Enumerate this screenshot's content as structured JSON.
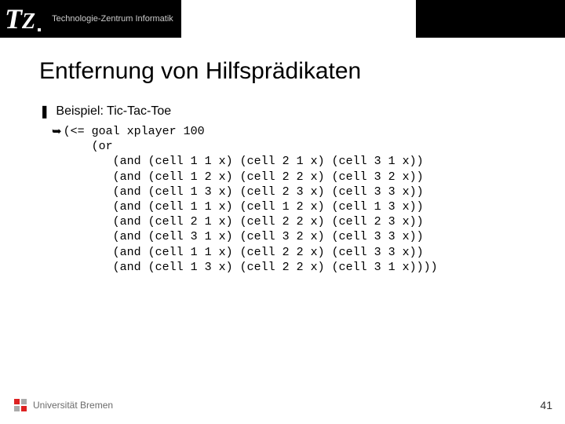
{
  "header": {
    "logo_t": "T",
    "logo_z": "Z",
    "subtitle": "Technologie-Zentrum Informatik"
  },
  "title": "Entfernung von Hilfsprädikaten",
  "bullet": {
    "symbol": "❚",
    "text": "Beispiel: Tic-Tac-Toe"
  },
  "code": {
    "symbol": "➥",
    "text": "(<= goal xplayer 100\n    (or\n       (and (cell 1 1 x) (cell 2 1 x) (cell 3 1 x))\n       (and (cell 1 2 x) (cell 2 2 x) (cell 3 2 x))\n       (and (cell 1 3 x) (cell 2 3 x) (cell 3 3 x))\n       (and (cell 1 1 x) (cell 1 2 x) (cell 1 3 x))\n       (and (cell 2 1 x) (cell 2 2 x) (cell 2 3 x))\n       (and (cell 3 1 x) (cell 3 2 x) (cell 3 3 x))\n       (and (cell 1 1 x) (cell 2 2 x) (cell 3 3 x))\n       (and (cell 1 3 x) (cell 2 2 x) (cell 3 1 x))))"
  },
  "footer": {
    "uni": "Universität Bremen",
    "page": "41"
  }
}
